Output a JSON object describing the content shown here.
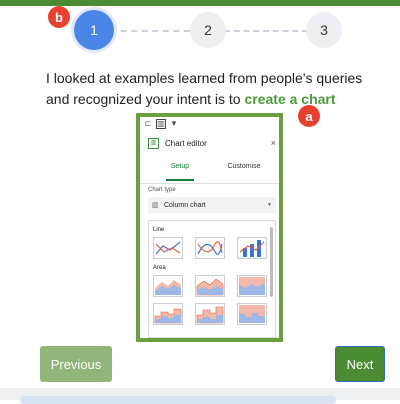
{
  "stepper": {
    "steps": [
      "1",
      "2",
      "3"
    ],
    "current": 1
  },
  "badges": {
    "b": "b",
    "a": "a"
  },
  "intent": {
    "prefix": "I looked at examples learned from people's queries and recognized your intent is to ",
    "highlight": "create a chart"
  },
  "chart_editor": {
    "title": "Chart editor",
    "close": "×",
    "tabs": [
      "Setup",
      "Customise"
    ],
    "active_tab": "Setup",
    "chart_type_label": "Chart type",
    "chart_type_value": "Column chart",
    "groups": [
      {
        "label": "Line",
        "thumbs": [
          "line-chart-thumb",
          "smooth-line-thumb",
          "combo-chart-thumb"
        ]
      },
      {
        "label": "Area",
        "thumbs": [
          "area-chart-thumb",
          "stacked-area-thumb",
          "100-area-thumb",
          "stepped-area-thumb",
          "stacked-stepped-area-thumb",
          "100-stepped-area-thumb"
        ]
      }
    ]
  },
  "buttons": {
    "previous": "Previous",
    "next": "Next"
  },
  "colors": {
    "accent_green": "#4b8b34",
    "step_active": "#4a86e8",
    "badge_red": "#e8402f",
    "highlight_text": "#4b9a3a"
  }
}
